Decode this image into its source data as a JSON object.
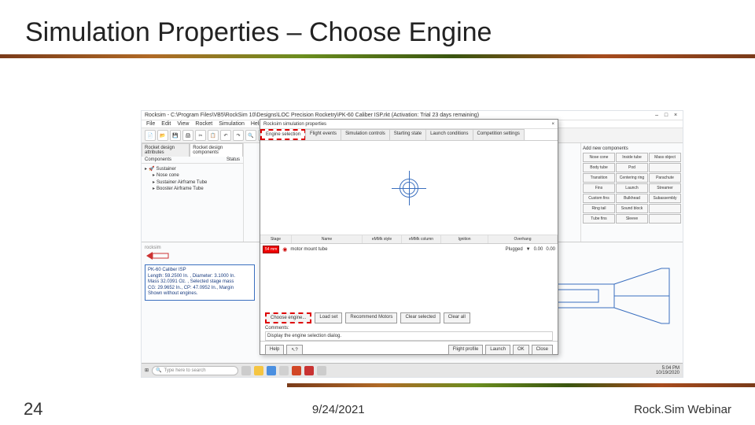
{
  "slide": {
    "title": "Simulation Properties – Choose Engine",
    "number": "24",
    "date": "9/24/2021",
    "footer_label": "Rock.Sim Webinar"
  },
  "app": {
    "title": "Rocksim - C:\\Program Files\\VB5\\RockSim 10\\Designs\\LOC Precision Rocketry\\PK-60 Caliber ISP.rkt (Activation: Trial 23 days remaining)",
    "window_controls": {
      "min": "–",
      "max": "□",
      "close": "×"
    },
    "menu": [
      "File",
      "Edit",
      "View",
      "Rocket",
      "Simulation",
      "Help"
    ],
    "left_tabs": [
      "Rocket design attributes",
      "Rocket design components"
    ],
    "tree": {
      "root": "Sustainer",
      "items": [
        "Nose cone",
        "Sustainer Airframe Tube",
        "Booster Airframe Tube"
      ]
    },
    "tree_header": {
      "col1": "Components",
      "col2": "Status"
    },
    "right_panel": {
      "header": "Add new components",
      "buttons": [
        "Nose cone",
        "Inside tube",
        "Mass object",
        "Body tube",
        "Pod",
        "Transition",
        "Centering ring",
        "Parachute",
        "Fins",
        "Launch",
        "Streamer",
        "Custom fins",
        "Bulkhead",
        "Subassembly",
        "Ring tail",
        "Sound block",
        "Tube fins",
        "Sleeve"
      ]
    },
    "lower": {
      "label": "rocksim",
      "info": "PK-60 Caliber ISP\nLength: 59.2500 In. , Diameter: 3.1000 In.\nMass 32.0391 Oz. , Selected stage mass\nCG: 29.9652 In., CP: 47.0952 In., Margin\nShown without engines."
    }
  },
  "dialog": {
    "title": "Rocksim simulation properties",
    "close": "×",
    "tabs": [
      "Engine selection",
      "Flight events",
      "Simulation controls",
      "Starting state",
      "Launch conditions",
      "Competition settings"
    ],
    "table_headers": [
      "Stage",
      "Name",
      "eMMk style",
      "eMMk column",
      "Ignition",
      "Overhang"
    ],
    "row": {
      "badge": "54 mm",
      "name": "motor mount tube",
      "ignition": "Plugged",
      "sep": "▼",
      "val1": "0.00",
      "val2": "0.00"
    },
    "buttons_row": [
      "Choose engine...",
      "Load set",
      "Recommend Motors",
      "Clear selected",
      "Clear all"
    ],
    "comments_label": "Comments:",
    "comments_text": "Display the engine selection dialog.",
    "footer": {
      "help": "Help",
      "whats_this": "?",
      "right": [
        "Flight profile",
        "Launch",
        "OK",
        "Close"
      ]
    }
  },
  "taskbar": {
    "start_icon": "⊞",
    "search_icon": "🔍",
    "search_placeholder": "Type here to search",
    "time": "5:04 PM",
    "date": "10/19/2020"
  }
}
